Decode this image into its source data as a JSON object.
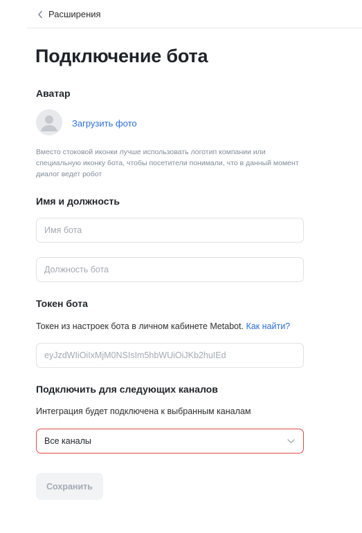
{
  "breadcrumb": {
    "back_label": "Расширения",
    "icon": "chevron-left-icon"
  },
  "page": {
    "title": "Подключение бота"
  },
  "avatar_section": {
    "title": "Аватар",
    "upload_label": "Загрузить фото",
    "avatar_icon": "user-placeholder-icon",
    "hint": "Вместо стоковой иконки лучше использовать логотип компании или специальную иконку бота, чтобы посетители понимали, что в данный момент диалог ведет робот"
  },
  "name_section": {
    "title": "Имя и должность",
    "name_placeholder": "Имя бота",
    "name_value": "",
    "position_placeholder": "Должность бота",
    "position_value": ""
  },
  "token_section": {
    "title": "Токен бота",
    "description": "Токен из настроек бота в личном кабинете Metabot.",
    "help_link": "Как найти?",
    "token_placeholder": "eyJzdWIiOiIxMjM0NSIsIm5hbWUiOiJKb2huIEd",
    "token_value": ""
  },
  "channels_section": {
    "title": "Подключить для следующих каналов",
    "description": "Интеграция будет подключена к выбранным каналам",
    "selected_value": "Все каналы",
    "dropdown_icon": "chevron-down-icon"
  },
  "actions": {
    "save_label": "Сохранить"
  },
  "colors": {
    "accent": "#2a6fd6",
    "error_border": "#e64646",
    "disabled_bg": "#f2f3f5"
  }
}
